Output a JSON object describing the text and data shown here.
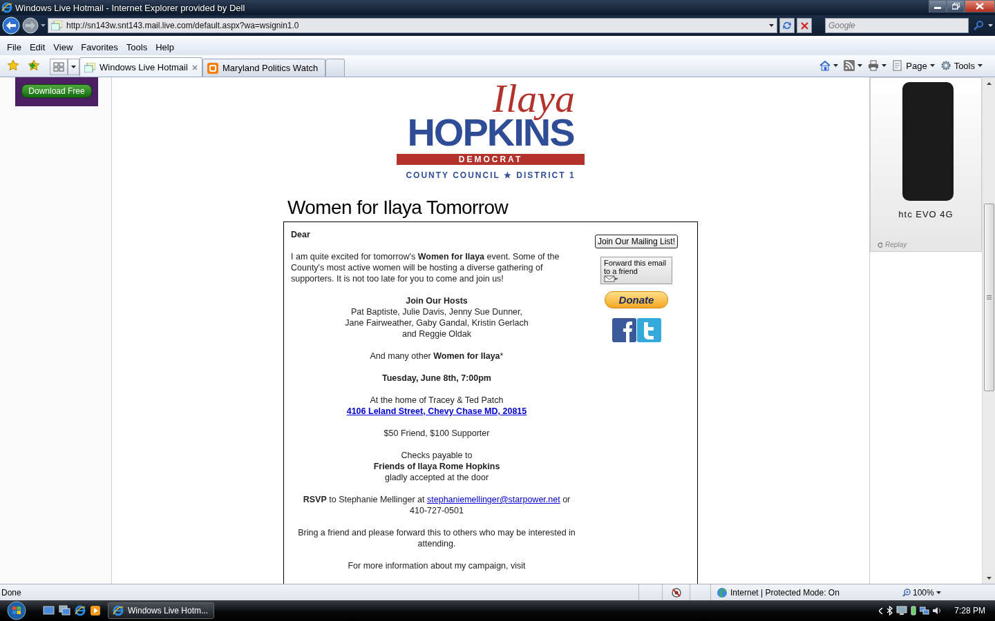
{
  "window": {
    "title": "Windows Live Hotmail - Internet Explorer provided by Dell"
  },
  "address_bar": {
    "url": "http://sn143w.snt143.mail.live.com/default.aspx?wa=wsignin1.0"
  },
  "search": {
    "placeholder": "Google"
  },
  "menu": [
    "File",
    "Edit",
    "View",
    "Favorites",
    "Tools",
    "Help"
  ],
  "tabs": [
    {
      "label": "Windows Live Hotmail",
      "selected": true
    },
    {
      "label": "Maryland Politics Watch",
      "selected": false
    }
  ],
  "command_bar": [
    {
      "kind": "home"
    },
    {
      "kind": "feeds"
    },
    {
      "kind": "print"
    },
    {
      "kind": "page",
      "label": "Page"
    },
    {
      "kind": "tools",
      "label": "Tools"
    }
  ],
  "left_ad": {
    "button": "Download Free"
  },
  "logo": {
    "script": "Ilaya",
    "name": "HOPKINS",
    "party": "DEMOCRAT",
    "office": "COUNTY COUNCIL ★ DISTRICT 1"
  },
  "email": {
    "heading": "Women for Ilaya Tomorrow",
    "paragraphs": [
      {
        "kind": "left",
        "lines": [
          {
            "kind": "bold",
            "text": "Dear"
          }
        ]
      },
      {
        "kind": "left",
        "lines": [
          {
            "kind": "text",
            "text": "I am quite excited for tomorrow's **Women for Ilaya** event. Some of the County's most active women will be hosting a diverse gathering of supporters. It is not too late for you to come and join us!"
          }
        ]
      },
      {
        "kind": "center",
        "lines": [
          {
            "kind": "bold",
            "text": "Join Our Hosts"
          },
          {
            "kind": "text",
            "text": "Pat Baptiste, Julie Davis, Jenny Sue Dunner,\nJane Fairweather, Gaby Gandal, Kristin Gerlach\nand Reggie Oldak"
          }
        ]
      },
      {
        "kind": "center",
        "lines": [
          {
            "kind": "text",
            "text": "And many other **Women for Ilaya***"
          }
        ]
      },
      {
        "kind": "center",
        "lines": [
          {
            "kind": "bold",
            "text": "Tuesday, June 8th, 7:00pm"
          }
        ]
      },
      {
        "kind": "center",
        "lines": [
          {
            "kind": "text",
            "text": "At the home of Tracey & Ted Patch"
          },
          {
            "kind": "link",
            "text": "4106 Leland Street, Chevy Chase MD, 20815"
          }
        ]
      },
      {
        "kind": "center",
        "lines": [
          {
            "kind": "text",
            "text": "$50 Friend, $100 Supporter"
          }
        ]
      },
      {
        "kind": "center",
        "lines": [
          {
            "kind": "text",
            "text": "Checks payable to"
          },
          {
            "kind": "bold",
            "text": "Friends of Ilaya Rome Hopkins"
          },
          {
            "kind": "text",
            "text": "gladly accepted at the door"
          }
        ]
      },
      {
        "kind": "center",
        "lines": [
          {
            "kind": "rsvp",
            "before": "**RSVP** to Stephanie Mellinger at ",
            "email": "stephaniemellinger@starpower.net",
            "after": " or 410-727-0501"
          }
        ]
      },
      {
        "kind": "center",
        "lines": [
          {
            "kind": "text",
            "text": "Bring a friend and please forward this to others who may be interested in attending."
          }
        ]
      },
      {
        "kind": "center",
        "lines": [
          {
            "kind": "text",
            "text": "For more information about my campaign, visit"
          }
        ]
      }
    ],
    "sidebar": {
      "mailing_list": "Join Our Mailing List!",
      "forward": "Forward this email to a friend",
      "donate": "Donate"
    }
  },
  "right_ad": {
    "brand": "htc EVO 4G",
    "replay": "Replay"
  },
  "status_bar": {
    "text": "Done",
    "zone": "Internet | Protected Mode: On",
    "zoom": "100%"
  },
  "taskbar": {
    "task": "Windows Live Hotm...",
    "time": "7:28 PM"
  }
}
